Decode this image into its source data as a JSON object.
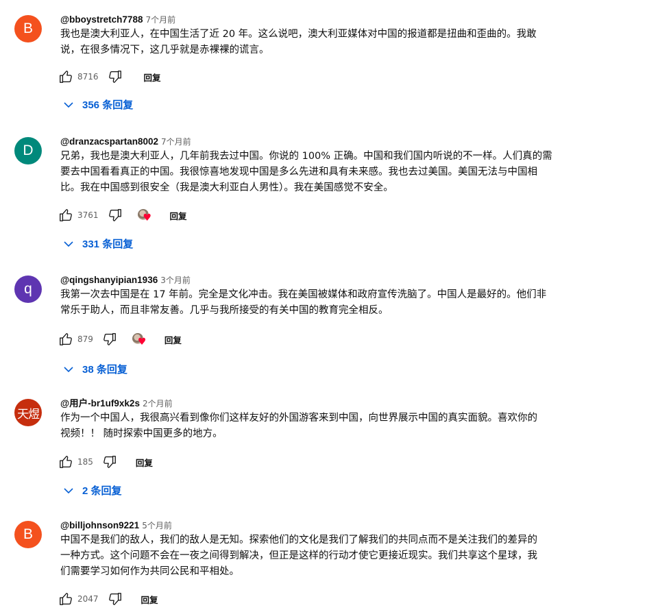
{
  "comments": [
    {
      "avatar": "B",
      "avatar_color": "#f4511e",
      "author": "@bboystretch7788",
      "time": "7个月前",
      "lines": [
        "我也是澳大利亚人，在中国生活了近 20 年。这么说吧，澳大利亚媒体对中国的报道都是扭曲和歪曲的。我敢",
        "说，在很多情况下，这几乎就是赤裸裸的谎言。"
      ],
      "likes": "8716",
      "reply_label": "回复",
      "replies_label": "356 条回复"
    },
    {
      "avatar": "D",
      "avatar_color": "#00897b",
      "author": "@dranzacspartan8002",
      "time": "7个月前",
      "lines": [
        "兄弟，我也是澳大利亚人，几年前我去过中国。你说的 100% 正确。中国和我们国内听说的不一样。人们真的需",
        "要去中国看看真正的中国。我很惊喜地发现中国是多么先进和具有未来感。我也去过美国。美国无法与中国相",
        "比。我在中国感到很安全（我是澳大利亚白人男性）。我在美国感觉不安全。"
      ],
      "likes": "3761",
      "reply_label": "回复",
      "replies_label": "331 条回复"
    },
    {
      "avatar": "q",
      "avatar_color": "#5e35b1",
      "author": "@qingshanyipian1936",
      "time": "3个月前",
      "lines": [
        "我第一次去中国是在 17 年前。完全是文化冲击。我在美国被媒体和政府宣传洗脑了。中国人是最好的。他们非",
        "常乐于助人，而且非常友善。几乎与我所接受的有关中国的教育完全相反。"
      ],
      "likes": "879",
      "reply_label": "回复",
      "replies_label": "38 条回复"
    },
    {
      "avatar": "天煜",
      "avatar_color": "#c62e0e",
      "author": "@用户-br1uf9xk2s",
      "time": "2个月前",
      "lines": [
        "作为一个中国人，我很高兴看到像你们这样友好的外国游客来到中国，向世界展示中国的真实面貌。喜欢你的",
        "视频！！ 随时探索中国更多的地方。"
      ],
      "likes": "185",
      "reply_label": "回复",
      "replies_label": "2 条回复"
    },
    {
      "avatar": "B",
      "avatar_color": "#f4511e",
      "author": "@billjohnson9221",
      "time": "5个月前",
      "lines": [
        "中国不是我们的敌人，我们的敌人是无知。探索他们的文化是我们了解我们的共同点而不是关注我们的差异的",
        "一种方式。这个问题不会在一夜之间得到解决，但正是这样的行动才使它更接近现实。我们共享这个星球，我",
        "们需要学习如何作为共同公民和平相处。"
      ],
      "likes": "2047",
      "reply_label": "回复"
    }
  ]
}
